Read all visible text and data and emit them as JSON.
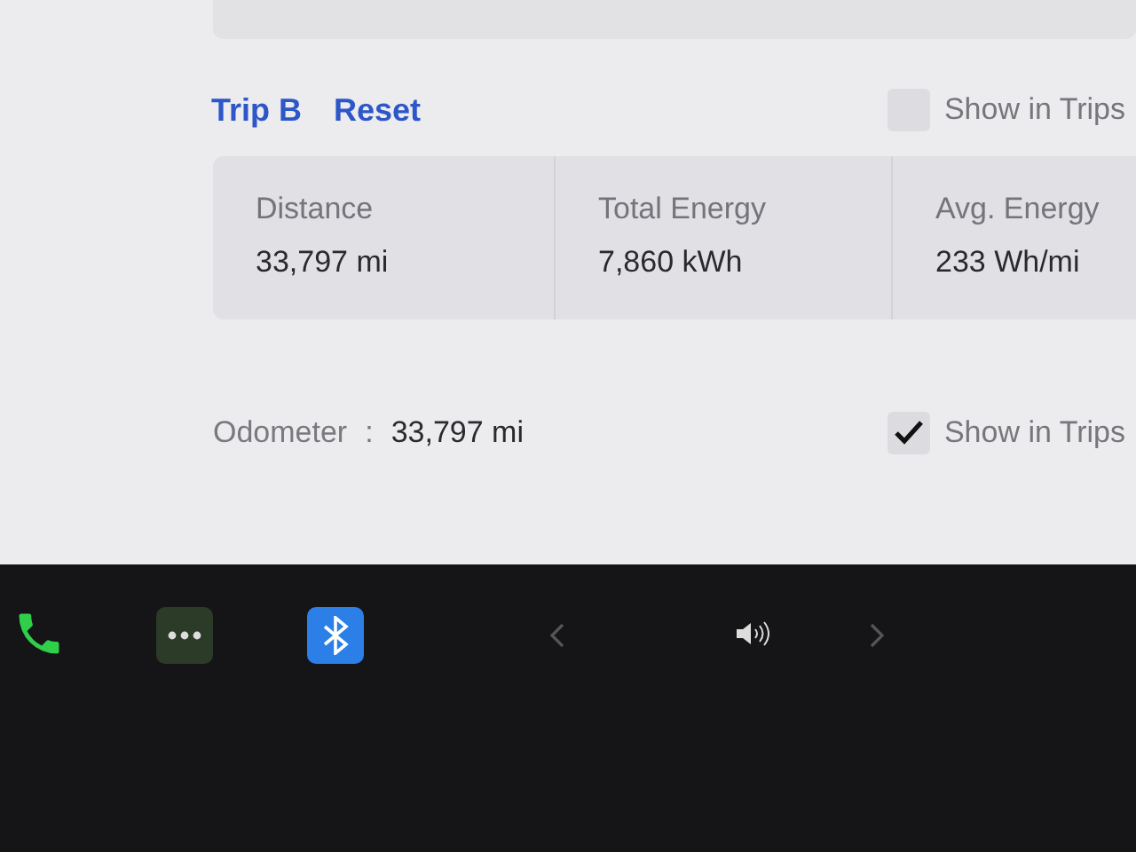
{
  "trip": {
    "title": "Trip B",
    "reset": "Reset",
    "show_in_trips": {
      "label": "Show in Trips",
      "checked": false
    },
    "stats": [
      {
        "label": "Distance",
        "value": "33,797 mi"
      },
      {
        "label": "Total Energy",
        "value": "7,860 kWh"
      },
      {
        "label": "Avg. Energy",
        "value": "233 Wh/mi"
      }
    ]
  },
  "odometer": {
    "label": "Odometer",
    "separator": ":",
    "value": "33,797 mi",
    "show_in_trips": {
      "label": "Show in Trips",
      "checked": true
    }
  }
}
